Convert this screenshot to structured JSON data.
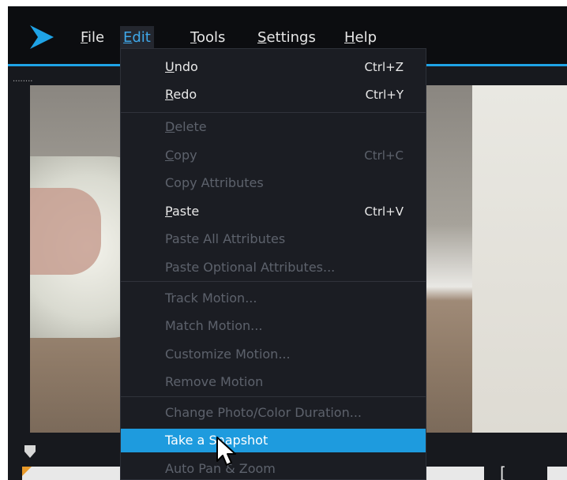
{
  "menubar": {
    "items": [
      {
        "mnemonic": "F",
        "rest": "ile"
      },
      {
        "mnemonic": "E",
        "rest": "dit"
      },
      {
        "mnemonic": "T",
        "rest": "ools"
      },
      {
        "mnemonic": "S",
        "rest": "ettings"
      },
      {
        "mnemonic": "H",
        "rest": "elp"
      }
    ]
  },
  "edit_menu": {
    "items": [
      {
        "mnemonic": "U",
        "rest": "ndo",
        "shortcut": "Ctrl+Z",
        "enabled": true
      },
      {
        "mnemonic": "R",
        "rest": "edo",
        "shortcut": "Ctrl+Y",
        "enabled": true
      },
      {
        "mnemonic": "D",
        "rest": "elete",
        "shortcut": "",
        "enabled": false
      },
      {
        "mnemonic": "C",
        "rest": "opy",
        "shortcut": "Ctrl+C",
        "enabled": false
      },
      {
        "mnemonic": "",
        "rest": "Copy Attributes",
        "shortcut": "",
        "enabled": false
      },
      {
        "mnemonic": "P",
        "rest": "aste",
        "shortcut": "Ctrl+V",
        "enabled": true
      },
      {
        "mnemonic": "",
        "rest": "Paste All Attributes",
        "shortcut": "",
        "enabled": false
      },
      {
        "mnemonic": "",
        "rest": "Paste Optional Attributes...",
        "shortcut": "",
        "enabled": false
      },
      {
        "mnemonic": "",
        "rest": "Track Motion...",
        "shortcut": "",
        "enabled": false
      },
      {
        "mnemonic": "",
        "rest": "Match Motion...",
        "shortcut": "",
        "enabled": false
      },
      {
        "mnemonic": "",
        "rest": "Customize Motion...",
        "shortcut": "",
        "enabled": false
      },
      {
        "mnemonic": "",
        "rest": "Remove Motion",
        "shortcut": "",
        "enabled": false
      },
      {
        "mnemonic": "",
        "rest": "Change Photo/Color Duration...",
        "shortcut": "",
        "enabled": false
      },
      {
        "mnemonic": "",
        "rest": "Take a Snapshot",
        "shortcut": "",
        "enabled": true,
        "highlighted": true
      },
      {
        "mnemonic": "",
        "rest": "Auto Pan & Zoom",
        "shortcut": "",
        "enabled": false
      }
    ]
  },
  "timeline": {
    "dots": "........",
    "bracket": "["
  },
  "colors": {
    "accent": "#1fa3e6",
    "highlight": "#1e9bde",
    "menu_bg": "#1b1d23",
    "disabled_text": "#5d626c",
    "trim_marker": "#e89a2a"
  }
}
